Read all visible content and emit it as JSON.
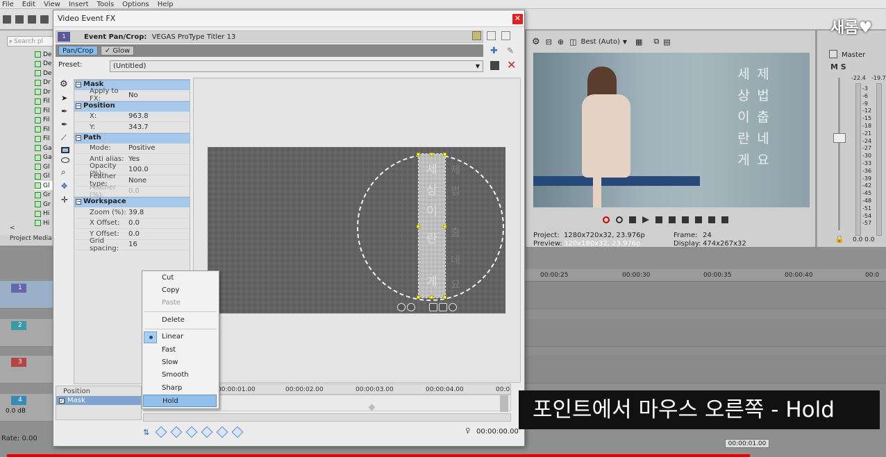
{
  "menubar": [
    "File",
    "Edit",
    "View",
    "Insert",
    "Tools",
    "Options",
    "Help"
  ],
  "explorer": {
    "search_placeholder": "Search pl",
    "items": [
      "De",
      "De",
      "De",
      "Dr",
      "Dr",
      "Fil",
      "Fil",
      "Fil",
      "Fil",
      "Fil",
      "Ga",
      "Ga",
      "Gl",
      "Gl",
      "Gl",
      "Gr",
      "Gr",
      "Hi",
      "Hi"
    ],
    "selected_index": 14,
    "caption": "Project Media"
  },
  "fx": {
    "title": "Video Event FX",
    "track_badge": "1",
    "header_label": "Event Pan/Crop:",
    "header_plugin": "VEGAS ProType Titler 13",
    "chain": [
      "Pan/Crop",
      "Glow"
    ],
    "preset_label": "Preset:",
    "preset_value": "(Untitled)",
    "sections": [
      {
        "title": "Mask",
        "rows": [
          {
            "k": "Apply to FX:",
            "v": "No"
          }
        ]
      },
      {
        "title": "Position",
        "rows": [
          {
            "k": "X:",
            "v": "963.8"
          },
          {
            "k": "Y:",
            "v": "343.7"
          }
        ]
      },
      {
        "title": "Path",
        "rows": [
          {
            "k": "Mode:",
            "v": "Positive"
          },
          {
            "k": "Anti alias:",
            "v": "Yes"
          },
          {
            "k": "Opacity (%):",
            "v": "100.0"
          },
          {
            "k": "Feather type:",
            "v": "None"
          },
          {
            "k": "Feather (%):",
            "v": "0.0"
          }
        ]
      },
      {
        "title": "Workspace",
        "rows": [
          {
            "k": "Zoom (%):",
            "v": "39.8"
          },
          {
            "k": "X Offset:",
            "v": "0.0"
          },
          {
            "k": "Y Offset:",
            "v": "0.0"
          },
          {
            "k": "Grid spacing:",
            "v": "16"
          }
        ]
      }
    ],
    "mask_text_col1": [
      "세",
      "상",
      "이",
      "란",
      "게"
    ],
    "mask_text_col2": [
      "제",
      "법",
      "춥",
      "네",
      "요"
    ],
    "kf_ticks": [
      "00:00:01.00",
      "00:00:02.00",
      "00:00:03.00",
      "00:00:04.00",
      "00:0"
    ],
    "kf_position_label": "Position",
    "kf_mask_label": "Mask",
    "kf_time": "00:00:00.00"
  },
  "context_menu": {
    "items": [
      {
        "label": "Cut",
        "disabled": false
      },
      {
        "label": "Copy",
        "disabled": false
      },
      {
        "label": "Paste",
        "disabled": true
      },
      {
        "label": "Delete",
        "disabled": false
      },
      {
        "label": "Linear",
        "disabled": false,
        "checked": true
      },
      {
        "label": "Fast",
        "disabled": false
      },
      {
        "label": "Slow",
        "disabled": false
      },
      {
        "label": "Smooth",
        "disabled": false
      },
      {
        "label": "Sharp",
        "disabled": false
      },
      {
        "label": "Hold",
        "disabled": false,
        "highlighted": true
      }
    ]
  },
  "preview": {
    "quality": "Best (Auto)",
    "video_text_col1": [
      "세",
      "상",
      "이",
      "란",
      "게"
    ],
    "video_text_col2": [
      "제",
      "법",
      "춥",
      "네",
      "요"
    ],
    "project_label": "Project:",
    "project_value": "1280x720x32, 23.976p",
    "preview_label": "Preview:",
    "preview_value": "320x180x32, 23.976p",
    "frame_label": "Frame:",
    "frame_value": "24",
    "display_label": "Display:",
    "display_value": "474x267x32"
  },
  "master": {
    "label": "Master",
    "ms": "M S",
    "peak_left": "-22.4",
    "peak_right": "-19.7",
    "scale": [
      "3",
      "6",
      "9",
      "12",
      "15",
      "18",
      "21",
      "24",
      "27",
      "30",
      "33",
      "36",
      "39",
      "42",
      "45",
      "48",
      "51",
      "54",
      "57"
    ],
    "vals": "0.0   0.0"
  },
  "timeline": {
    "ticks": [
      "00:00:25",
      "00:00:30",
      "00:00:35",
      "00:00:40",
      "00:0"
    ],
    "tracks": [
      "1",
      "2",
      "3",
      "4"
    ],
    "track4_db": "0.0 dB",
    "rate": "Rate: 0.00",
    "cursor_time": "00:00:01.00"
  },
  "watermark": "새롬♥",
  "subtitle": "포인트에서 마우스 오른쪽 - Hold",
  "colors": {
    "section_header": "#a6c8ea",
    "menu_highlight": "#91c0ea",
    "close_button": "#dd2222",
    "progress_red": "#ee0000"
  }
}
